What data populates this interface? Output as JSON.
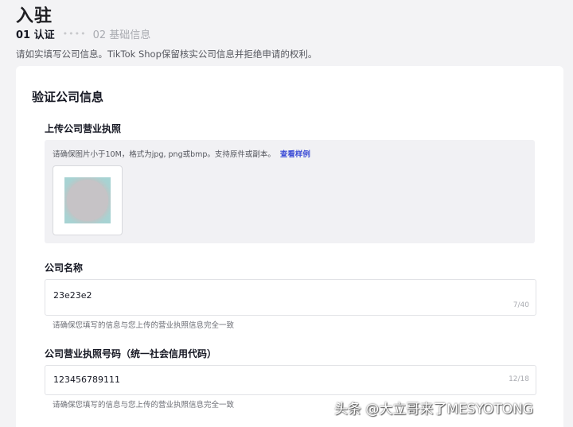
{
  "header": {
    "title": "入驻",
    "steps": [
      {
        "label": "01 认证",
        "active": true
      },
      {
        "label": "02 基础信息",
        "active": false
      }
    ],
    "step_dots": "••••",
    "notice": "请如实填写公司信息。TikTok Shop保留核实公司信息并拒绝申请的权利。"
  },
  "card": {
    "title": "验证公司信息",
    "license": {
      "label": "上传公司营业执照",
      "hint": "请确保图片小于10M，格式为jpg, png或bmp。支持原件或副本。",
      "sample_link": "查看样例"
    },
    "company_name": {
      "label": "公司名称",
      "value": "23e23e2",
      "counter": "7/40",
      "help": "请确保您填写的信息与您上传的营业执照信息完全一致"
    },
    "license_number": {
      "label": "公司营业执照号码（统一社会信用代码）",
      "value": "123456789111",
      "counter": "12/18",
      "help": "请确保您填写的信息与您上传的营业执照信息完全一致"
    }
  },
  "watermark": "头条 @大立哥来了MESYOTONG",
  "colors": {
    "link": "#3f4fd6",
    "page_bg": "#f3f3f5",
    "upload_bg": "#f1f1f4"
  }
}
